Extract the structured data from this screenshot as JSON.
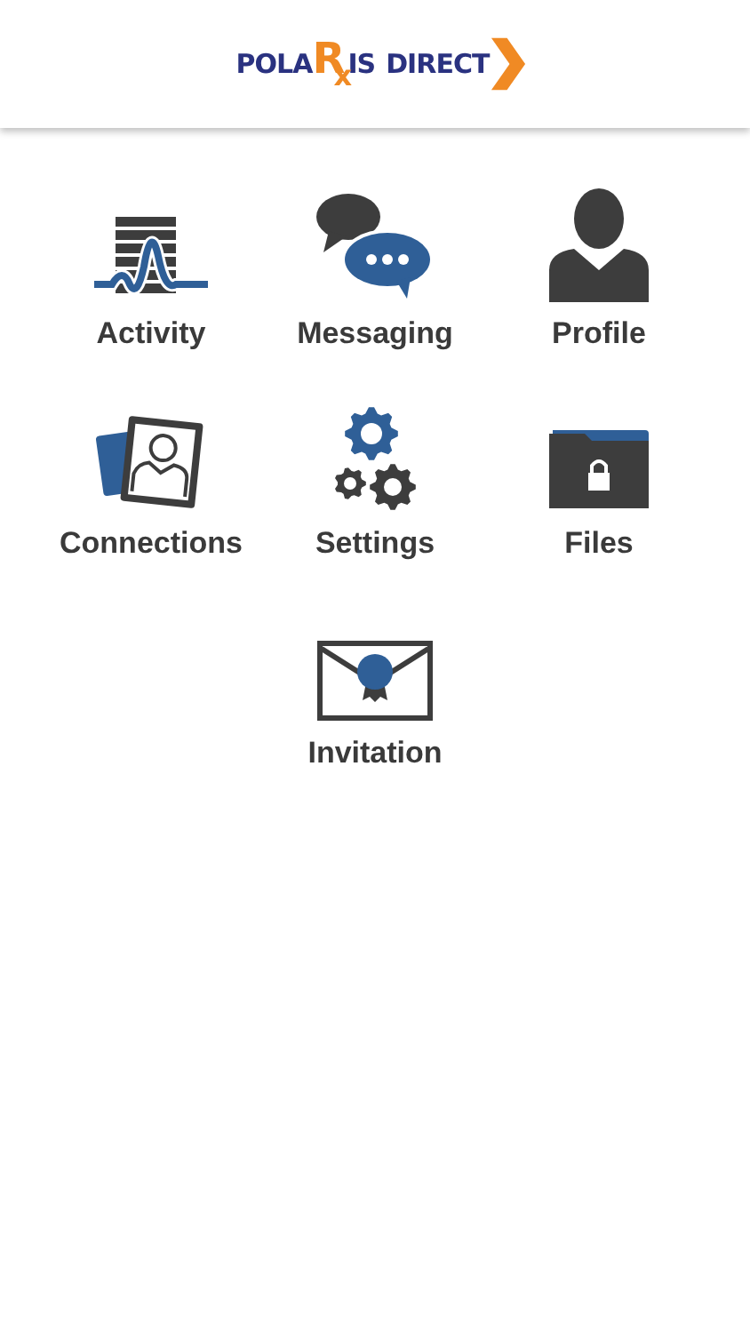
{
  "logo": {
    "before": "POLA",
    "highlight": "R",
    "after": "IS",
    "second": "DIRECT",
    "sub": "x"
  },
  "menu": [
    {
      "kind": "activity",
      "label": "Activity"
    },
    {
      "kind": "messaging",
      "label": "Messaging"
    },
    {
      "kind": "profile",
      "label": "Profile"
    },
    {
      "kind": "connections",
      "label": "Connections"
    },
    {
      "kind": "settings",
      "label": "Settings"
    },
    {
      "kind": "files",
      "label": "Files"
    },
    {
      "kind": "invitation",
      "label": "Invitation"
    }
  ]
}
